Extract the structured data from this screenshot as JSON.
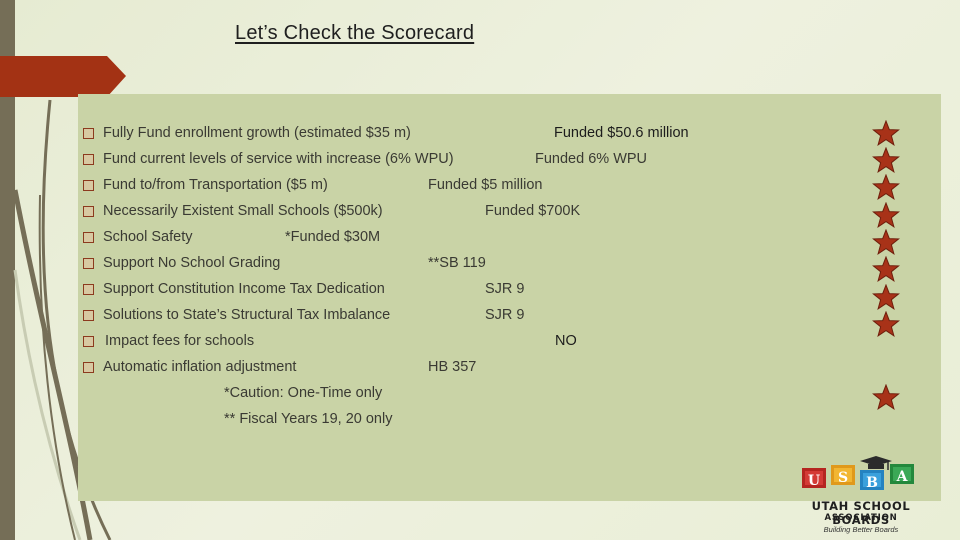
{
  "slide": {
    "title": "Let’s Check the Scorecard"
  },
  "scorecard": {
    "items": [
      {
        "label": "Fully Fund enrollment growth (estimated $35 m)",
        "result": "Funded $50.6 million",
        "star": true
      },
      {
        "label": "Fund current levels of service with increase (6% WPU)",
        "result": "Funded 6% WPU",
        "star": true
      },
      {
        "label": "Fund to/from Transportation ($5 m)",
        "result": "Funded $5 million",
        "star": true
      },
      {
        "label": "Necessarily Existent Small Schools ($500k)",
        "result": "Funded $700K",
        "star": true
      },
      {
        "label": "School Safety",
        "result": "*Funded $30M",
        "star": true
      },
      {
        "label": "Support No School Grading",
        "result": "**SB 119",
        "star": true
      },
      {
        "label": "Support Constitution Income Tax Dedication",
        "result": "SJR 9",
        "star": true
      },
      {
        "label": "Solutions to State’s Structural Tax Imbalance",
        "result": "SJR 9",
        "star": true
      },
      {
        "label": " Impact fees for schools",
        "result": "NO",
        "star": false
      },
      {
        "label": "Automatic inflation adjustment",
        "result": "HB 357",
        "star": true
      }
    ],
    "notes": [
      "*Caution: One-Time only",
      "** Fiscal Years 19, 20 only"
    ]
  },
  "logo": {
    "blocks": [
      "U",
      "S",
      "B",
      "A"
    ],
    "name": "UTAH SCHOOL BOARDS",
    "subtitle": "ASSOCIATION",
    "tagline": "Building Better Boards"
  },
  "colors": {
    "accent_red": "#a33214",
    "panel": "#c9d3a6",
    "sidebar": "#756e57",
    "star": "#a83218"
  }
}
